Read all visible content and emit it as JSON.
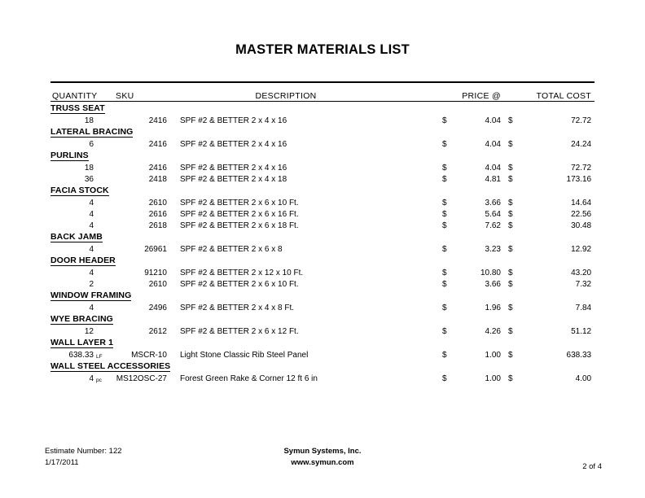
{
  "document": {
    "title": "MASTER MATERIALS LIST"
  },
  "table": {
    "columns": {
      "quantity": "QUANTITY",
      "sku": "SKU",
      "description": "DESCRIPTION",
      "price": "PRICE @",
      "total": "TOTAL COST"
    },
    "currency_symbol": "$",
    "sections": [
      {
        "label": "TRUSS SEAT",
        "items": [
          {
            "quantity": "18",
            "unit": "",
            "sku": "2416",
            "description": "SPF #2 & BETTER 2 x 4 x 16",
            "price": "4.04",
            "total": "72.72"
          }
        ]
      },
      {
        "label": "LATERAL BRACING",
        "items": [
          {
            "quantity": "6",
            "unit": "",
            "sku": "2416",
            "description": "SPF #2 & BETTER 2 x 4 x 16",
            "price": "4.04",
            "total": "24.24"
          }
        ]
      },
      {
        "label": "PURLINS",
        "items": [
          {
            "quantity": "18",
            "unit": "",
            "sku": "2416",
            "description": "SPF #2 & BETTER 2 x 4 x 16",
            "price": "4.04",
            "total": "72.72"
          },
          {
            "quantity": "36",
            "unit": "",
            "sku": "2418",
            "description": "SPF #2 & BETTER 2 x 4 x 18",
            "price": "4.81",
            "total": "173.16"
          }
        ]
      },
      {
        "label": "FACIA STOCK",
        "items": [
          {
            "quantity": "4",
            "unit": "",
            "sku": "2610",
            "description": "SPF #2 & BETTER 2 x 6 x 10 Ft.",
            "price": "3.66",
            "total": "14.64"
          },
          {
            "quantity": "4",
            "unit": "",
            "sku": "2616",
            "description": "SPF #2 & BETTER 2 x 6 x 16 Ft.",
            "price": "5.64",
            "total": "22.56"
          },
          {
            "quantity": "4",
            "unit": "",
            "sku": "2618",
            "description": "SPF #2 & BETTER 2 x 6 x 18 Ft.",
            "price": "7.62",
            "total": "30.48"
          }
        ]
      },
      {
        "label": "BACK JAMB",
        "items": [
          {
            "quantity": "4",
            "unit": "",
            "sku": "26961",
            "description": "SPF #2 & BETTER 2 x 6 x 8",
            "price": "3.23",
            "total": "12.92"
          }
        ]
      },
      {
        "label": "DOOR HEADER",
        "items": [
          {
            "quantity": "4",
            "unit": "",
            "sku": "91210",
            "description": "SPF #2 & BETTER 2 x 12 x 10 Ft.",
            "price": "10.80",
            "total": "43.20"
          },
          {
            "quantity": "2",
            "unit": "",
            "sku": "2610",
            "description": "SPF #2 & BETTER 2 x 6 x 10 Ft.",
            "price": "3.66",
            "total": "7.32"
          }
        ]
      },
      {
        "label": "WINDOW FRAMING",
        "items": [
          {
            "quantity": "4",
            "unit": "",
            "sku": "2496",
            "description": "SPF #2 & BETTER 2 x 4 x 8 Ft.",
            "price": "1.96",
            "total": "7.84"
          }
        ]
      },
      {
        "label": "WYE BRACING",
        "items": [
          {
            "quantity": "12",
            "unit": "",
            "sku": "2612",
            "description": "SPF #2 & BETTER 2 x 6 x 12 Ft.",
            "price": "4.26",
            "total": "51.12"
          }
        ]
      },
      {
        "label": "WALL LAYER 1",
        "items": [
          {
            "quantity": "638.33",
            "unit": "LF",
            "sku": "MSCR-10",
            "description": "Light Stone Classic Rib Steel Panel",
            "price": "1.00",
            "total": "638.33"
          }
        ]
      },
      {
        "label": "WALL STEEL ACCESSORIES",
        "items": [
          {
            "quantity": "4",
            "unit": "pc",
            "sku": "MS12OSC-27",
            "description": "Forest Green Rake & Corner 12 ft 6 in",
            "price": "1.00",
            "total": "4.00"
          }
        ]
      }
    ]
  },
  "footer": {
    "estimate_number": "Estimate Number: 122",
    "date": "1/17/2011",
    "company": "Symun Systems, Inc.",
    "website": "www.symun.com",
    "page": "2 of 4"
  }
}
